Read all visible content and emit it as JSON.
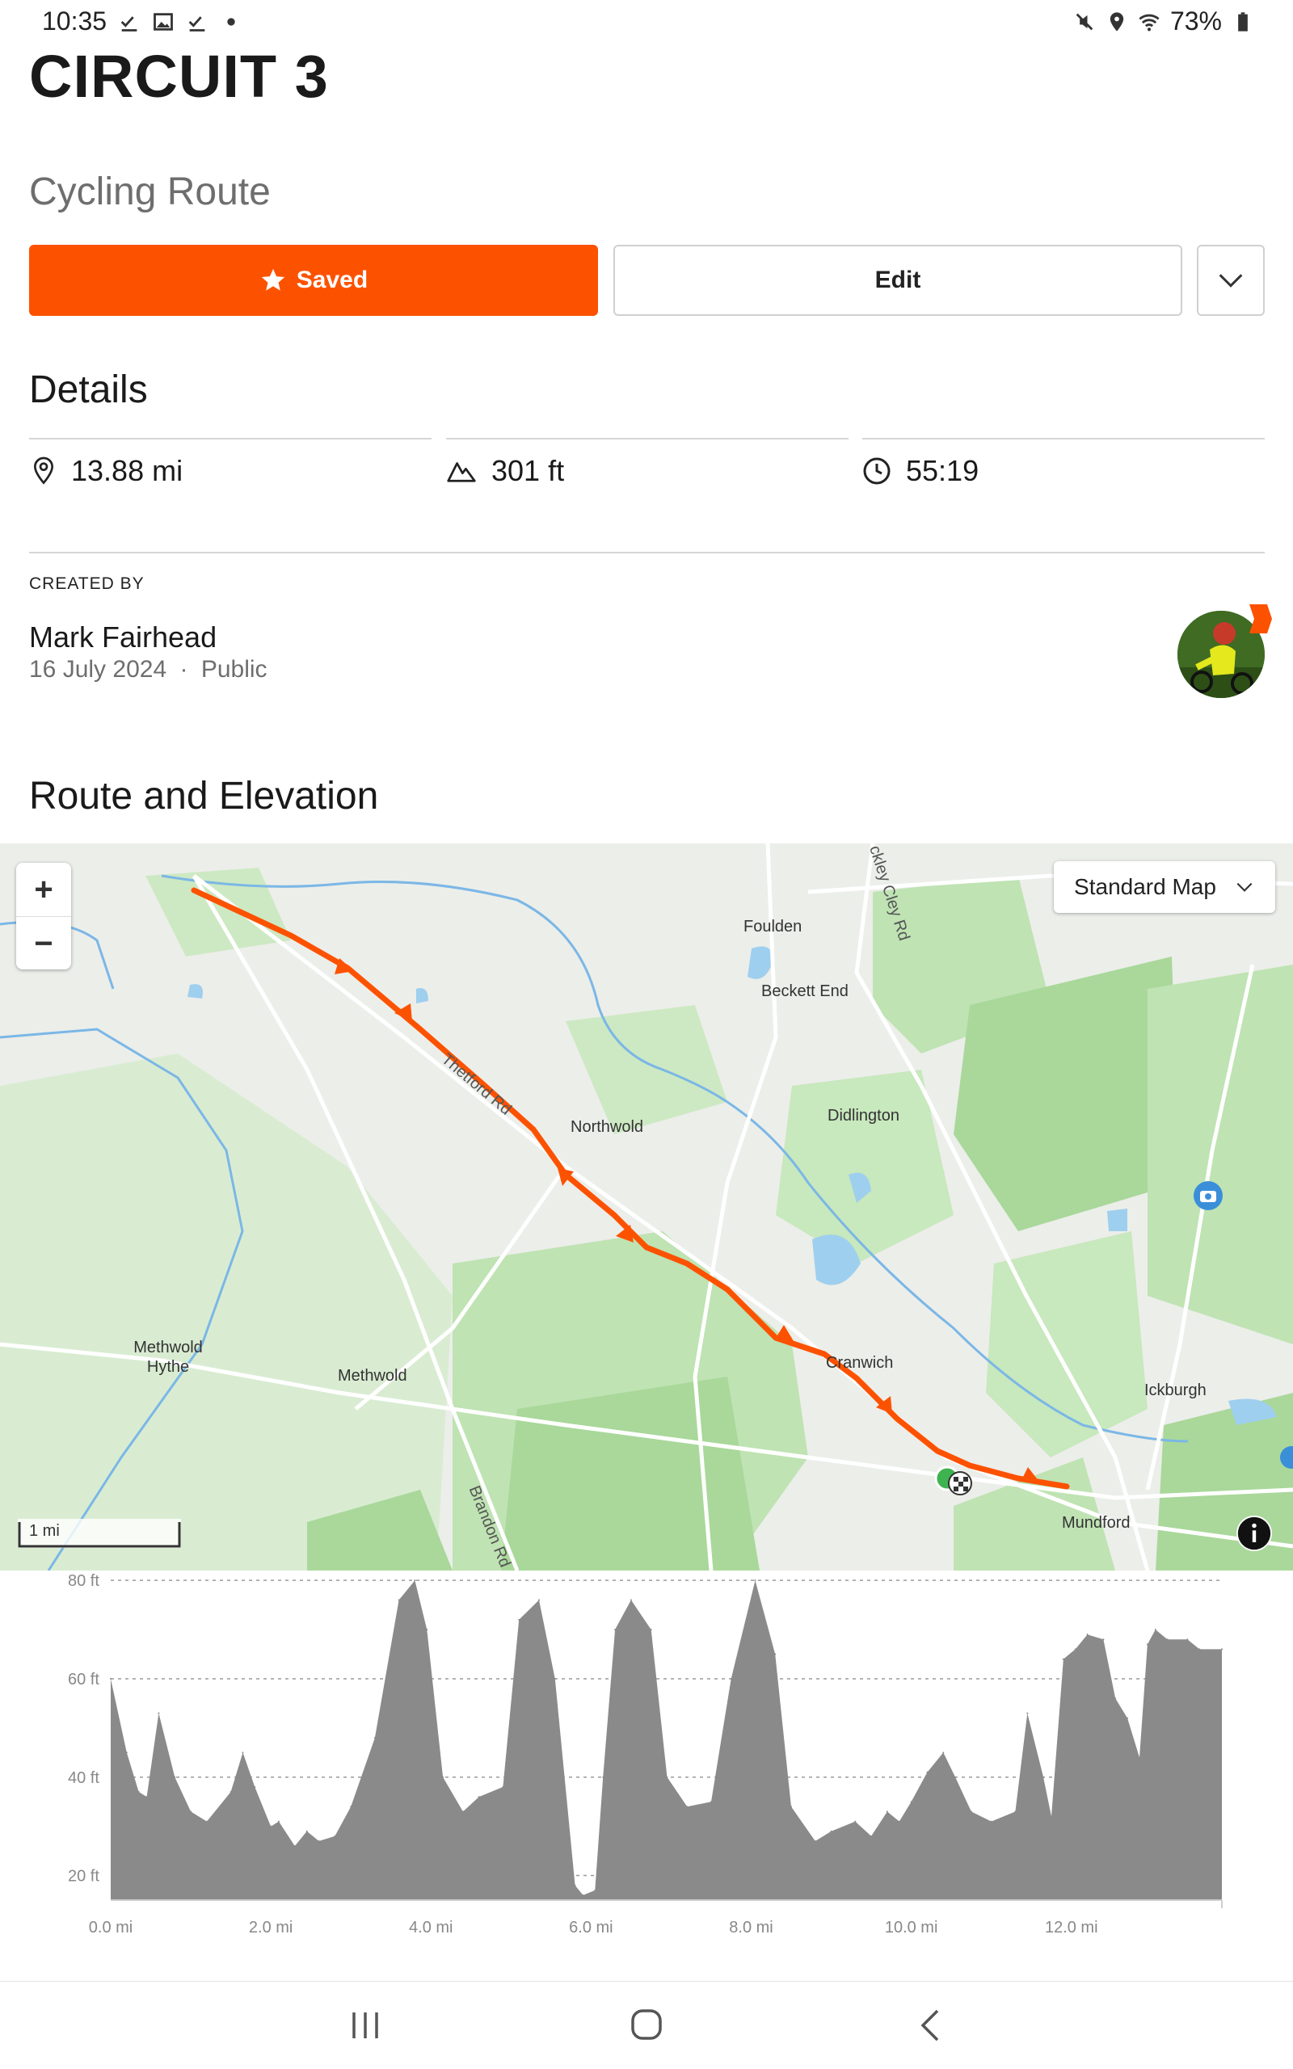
{
  "status_bar": {
    "time": "10:35",
    "battery": "73%"
  },
  "route": {
    "title": "CIRCUIT 3",
    "type": "Cycling Route",
    "saved_label": "Saved",
    "edit_label": "Edit"
  },
  "details": {
    "heading": "Details",
    "distance": "13.88 mi",
    "elevation": "301 ft",
    "time": "55:19"
  },
  "created": {
    "label": "CREATED BY",
    "name": "Mark Fairhead",
    "date": "16 July 2024",
    "separator": "·",
    "visibility": "Public"
  },
  "route_elevation": {
    "heading": "Route and Elevation",
    "map_type": "Standard Map",
    "scale_label": "1 mi",
    "place_labels": [
      "Foulden",
      "Beckett End",
      "Northwold",
      "Didlington",
      "Cranwich",
      "Methwold Hythe",
      "Methwold",
      "Ickburgh",
      "Mundford"
    ],
    "road_labels": [
      "Thetford Rd",
      "Brandon Rd",
      "ckley Cley Rd"
    ]
  },
  "chart_data": {
    "type": "area",
    "xlabel": "",
    "ylabel": "",
    "x_ticks": [
      "0.0 mi",
      "2.0 mi",
      "4.0 mi",
      "6.0 mi",
      "8.0 mi",
      "10.0 mi",
      "12.0 mi"
    ],
    "y_ticks": [
      "80 ft",
      "60 ft",
      "40 ft",
      "20 ft"
    ],
    "xlim": [
      0,
      13.88
    ],
    "ylim": [
      15,
      82
    ],
    "grid": true,
    "x": [
      0.0,
      0.2,
      0.35,
      0.45,
      0.6,
      0.8,
      1.0,
      1.2,
      1.5,
      1.65,
      1.8,
      2.0,
      2.1,
      2.3,
      2.45,
      2.6,
      2.8,
      3.0,
      3.3,
      3.6,
      3.8,
      3.95,
      4.15,
      4.4,
      4.6,
      4.9,
      5.1,
      5.35,
      5.55,
      5.8,
      5.9,
      6.05,
      6.15,
      6.3,
      6.5,
      6.75,
      6.95,
      7.2,
      7.5,
      7.75,
      8.05,
      8.3,
      8.5,
      8.8,
      9.0,
      9.3,
      9.5,
      9.7,
      9.85,
      10.0,
      10.2,
      10.4,
      10.55,
      10.75,
      11.0,
      11.3,
      11.45,
      11.65,
      11.75,
      11.9,
      12.05,
      12.2,
      12.4,
      12.55,
      12.7,
      12.85,
      12.95,
      13.05,
      13.2,
      13.45,
      13.6,
      13.88
    ],
    "y": [
      60,
      45,
      37,
      36,
      53,
      40,
      33,
      31,
      37,
      45,
      38,
      30,
      31,
      26,
      29,
      27,
      28,
      34,
      48,
      76,
      80,
      70,
      40,
      33,
      36,
      38,
      72,
      76,
      60,
      18,
      16,
      17,
      40,
      70,
      76,
      70,
      40,
      34,
      35,
      60,
      80,
      65,
      34,
      27,
      29,
      31,
      28,
      33,
      31,
      35,
      41,
      45,
      40,
      33,
      31,
      33,
      53,
      40,
      32,
      64,
      66,
      69,
      68,
      56,
      52,
      44,
      67,
      70,
      68,
      68,
      66,
      66
    ]
  }
}
